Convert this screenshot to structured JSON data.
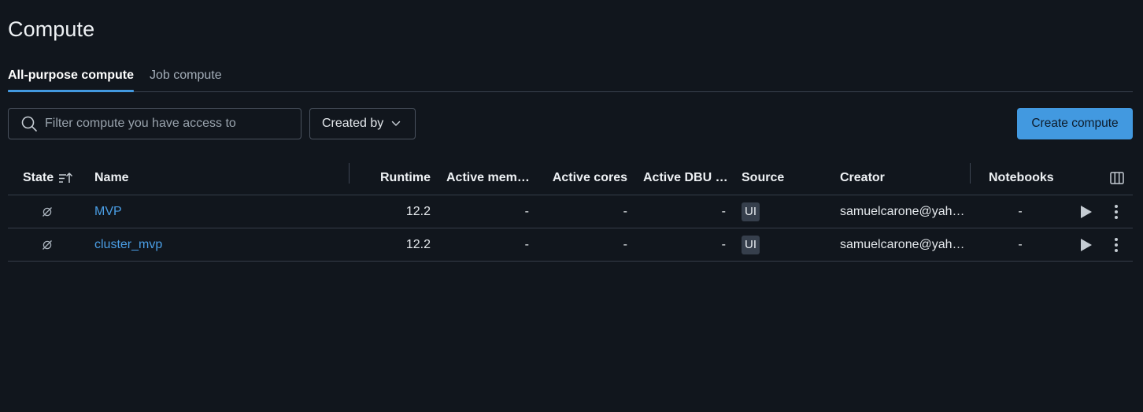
{
  "page": {
    "title": "Compute"
  },
  "tabs": [
    {
      "label": "All-purpose compute",
      "active": true
    },
    {
      "label": "Job compute",
      "active": false
    }
  ],
  "toolbar": {
    "search_placeholder": "Filter compute you have access to",
    "created_by_label": "Created by",
    "create_label": "Create compute"
  },
  "table": {
    "columns": {
      "state": "State",
      "name": "Name",
      "runtime": "Runtime",
      "active_memory": "Active mem…",
      "active_cores": "Active cores",
      "active_dbu": "Active DBU …",
      "source": "Source",
      "creator": "Creator",
      "notebooks": "Notebooks"
    },
    "rows": [
      {
        "state_icon": "terminated-icon",
        "name": "MVP",
        "runtime": "12.2",
        "active_memory": "-",
        "active_cores": "-",
        "active_dbu": "-",
        "source": "UI",
        "creator": "samuelcarone@yah…",
        "notebooks": "-"
      },
      {
        "state_icon": "terminated-icon",
        "name": "cluster_mvp",
        "runtime": "12.2",
        "active_memory": "-",
        "active_cores": "-",
        "active_dbu": "-",
        "source": "UI",
        "creator": "samuelcarone@yah…",
        "notebooks": "-"
      }
    ]
  },
  "colors": {
    "background": "#11161d",
    "accent": "#4299e0",
    "link": "#4a9ee5",
    "border": "#353d49"
  }
}
